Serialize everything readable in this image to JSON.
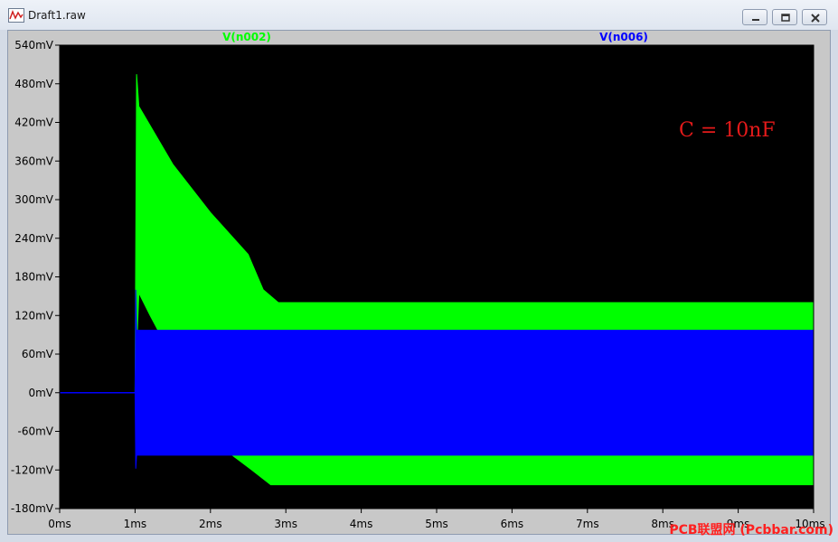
{
  "window": {
    "title": "Draft1.raw"
  },
  "chart_data": {
    "type": "area",
    "xlabel": "",
    "ylabel": "",
    "x_unit": "ms",
    "y_unit": "mV",
    "xlim": [
      0,
      10
    ],
    "ylim": [
      -180,
      540
    ],
    "x_ticks": [
      "0ms",
      "1ms",
      "2ms",
      "3ms",
      "4ms",
      "5ms",
      "6ms",
      "7ms",
      "8ms",
      "9ms",
      "10ms"
    ],
    "y_ticks": [
      "540mV",
      "480mV",
      "420mV",
      "360mV",
      "300mV",
      "240mV",
      "180mV",
      "120mV",
      "60mV",
      "0mV",
      "-60mV",
      "-120mV",
      "-180mV"
    ],
    "series": [
      {
        "name": "V(n002)",
        "color": "#00ff00",
        "envelope_upper": [
          [
            0,
            0
          ],
          [
            1,
            0
          ],
          [
            1.02,
            495
          ],
          [
            1.05,
            445
          ],
          [
            1.5,
            355
          ],
          [
            2,
            280
          ],
          [
            2.5,
            215
          ],
          [
            2.7,
            160
          ],
          [
            2.9,
            140
          ],
          [
            10,
            140
          ]
        ],
        "envelope_lower": [
          [
            0,
            0
          ],
          [
            1,
            0
          ],
          [
            1.05,
            155
          ],
          [
            1.2,
            120
          ],
          [
            1.3,
            98
          ],
          [
            2.3,
            -98
          ],
          [
            2.55,
            -120
          ],
          [
            2.8,
            -143
          ],
          [
            10,
            -143
          ]
        ]
      },
      {
        "name": "V(n006)",
        "color": "#0000ff",
        "envelope_upper": [
          [
            0,
            0
          ],
          [
            1,
            0
          ],
          [
            1.01,
            160
          ],
          [
            1.02,
            97
          ],
          [
            10,
            97
          ]
        ],
        "envelope_lower": [
          [
            0,
            0
          ],
          [
            1,
            0
          ],
          [
            1.01,
            -118
          ],
          [
            1.02,
            -97
          ],
          [
            10,
            -97
          ]
        ]
      }
    ],
    "annotation": "C = 10nF",
    "grid": false,
    "background": "#000000"
  },
  "watermark": "PCB联盟网 (Pcbbar.com)"
}
